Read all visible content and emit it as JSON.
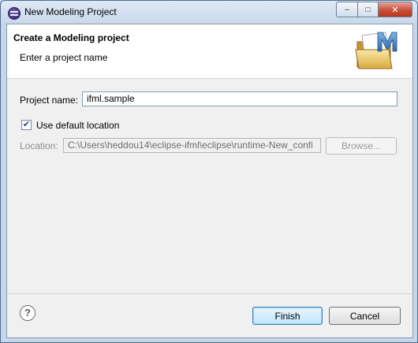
{
  "window": {
    "title": "New Modeling Project",
    "controls": {
      "minimize": "–",
      "maximize": "□",
      "close": "✕"
    }
  },
  "banner": {
    "title": "Create a Modeling project",
    "subtitle": "Enter a project name",
    "graphic_icon": "folder-with-m-icon",
    "graphic_letter": "M"
  },
  "form": {
    "project_name_label": "Project name:",
    "project_name_value": "ifml.sample",
    "use_default_label": "Use default location",
    "use_default_checked": true,
    "checkmark": "✔",
    "location_label": "Location:",
    "location_value": "C:\\Users\\heddou14\\eclipse-ifml\\eclipse\\runtime-New_confi",
    "browse_label": "Browse..."
  },
  "footer": {
    "help_icon": "help-icon",
    "help_glyph": "?",
    "finish_label": "Finish",
    "cancel_label": "Cancel"
  },
  "colors": {
    "title_frame": "#c7d7ea",
    "dialog_bg": "#f0f0f0",
    "banner_bg": "#ffffff",
    "default_button_border": "#3c7fb1",
    "close_button": "#c8503a"
  }
}
